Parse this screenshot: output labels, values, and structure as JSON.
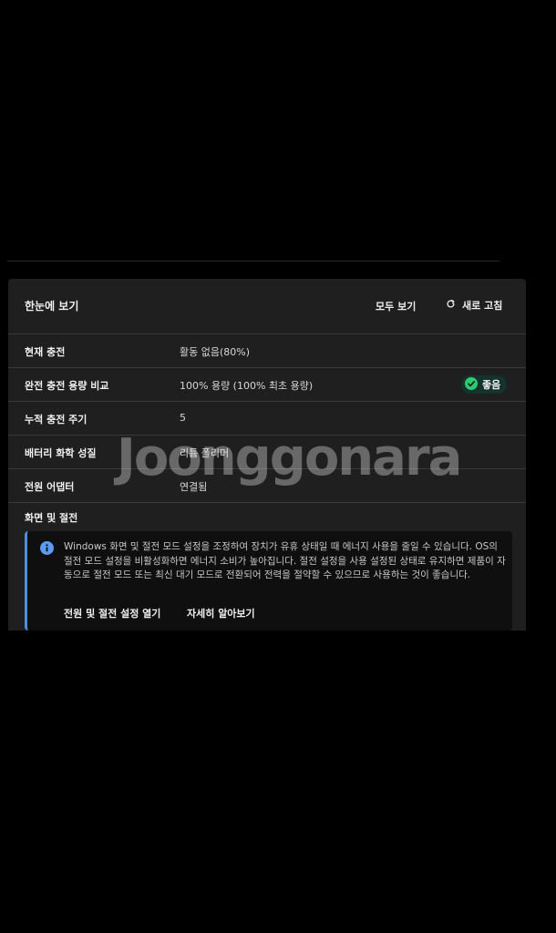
{
  "header": {
    "title": "한눈에 보기",
    "view_all_label": "모두 보기",
    "refresh_label": "새로 고침"
  },
  "rows": [
    {
      "label": "현재 충전",
      "value": "활동 없음(80%)"
    },
    {
      "label": "완전 충전 용량 비교",
      "value": "100% 용량 (100% 최초 용량)",
      "badge": "좋음"
    },
    {
      "label": "누적 충전 주기",
      "value": "5"
    },
    {
      "label": "배터리 화학 성질",
      "value": "리튬 폴리머"
    },
    {
      "label": "전원 어댑터",
      "value": "연결됨"
    }
  ],
  "section": {
    "title": "화면 및 절전",
    "info_text": "Windows 화면 및 절전 모드 설정을 조정하여 장치가 유휴 상태일 때 에너지 사용을 줄일 수 있습니다. OS의 절전 모드 설정을 비활성화하면 에너지 소비가 높아집니다. 절전 설정을 사용 설정된 상태로 유지하면 제품이 자동으로 절전 모드 또는 최신 대기 모드로 전환되어 전력을 절약할 수 있으므로 사용하는 것이 좋습니다.",
    "link_open": "전원 및 절전 설정 열기",
    "link_learn": "자세히 알아보기"
  },
  "watermark": "Joonggonara",
  "colors": {
    "background": "#000000",
    "panel": "#1f1f1f",
    "accent_blue": "#4a90e2",
    "good_green": "#2ecc71"
  },
  "icons": {
    "refresh": "refresh-icon",
    "good": "check-circle-icon",
    "info": "info-icon"
  }
}
